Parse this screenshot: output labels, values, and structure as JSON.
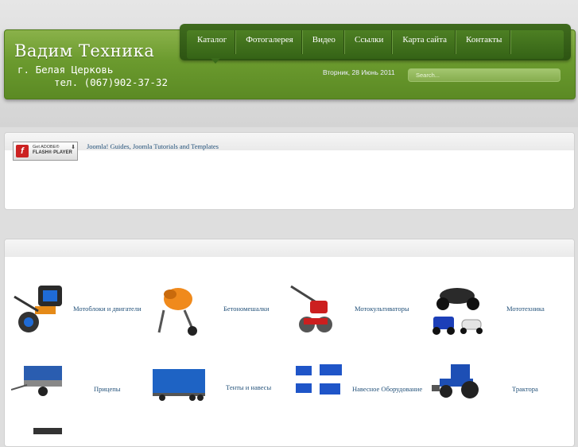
{
  "header": {
    "brand": "Вадим Техника",
    "city": "г. Белая Церковь",
    "phone": "тел. (067)902-37-32",
    "date": "Вторник, 28 Июнь 2011",
    "search_placeholder": "Search..."
  },
  "nav": {
    "items": [
      "Каталог",
      "Фотогалерея",
      "Видео",
      "Ссылки",
      "Карта сайта",
      "Контакты"
    ]
  },
  "banner": {
    "flash_line1": "Get ADOBE®",
    "flash_line2": "FLASH® PLAYER",
    "link": "Joomla! Guides, Joomla Tutorials and Templates"
  },
  "categories": [
    {
      "label": "Мотоблоки и двигатели",
      "icon": "motoblock-icon"
    },
    {
      "label": "Бетономешалки",
      "icon": "concrete-mixer-icon"
    },
    {
      "label": "Мотокультиваторы",
      "icon": "cultivator-icon"
    },
    {
      "label": "Мототехника",
      "icon": "motorbike-icon"
    },
    {
      "label": "Прицепы",
      "icon": "trailer-icon"
    },
    {
      "label": "Тенты и навесы",
      "icon": "tent-icon"
    },
    {
      "label": "Навесное Оборудование",
      "icon": "attachment-icon"
    },
    {
      "label": "Трактора",
      "icon": "tractor-icon"
    }
  ],
  "colors": {
    "accent": "#6b9a2e",
    "nav": "#356316",
    "link": "#24527a"
  }
}
